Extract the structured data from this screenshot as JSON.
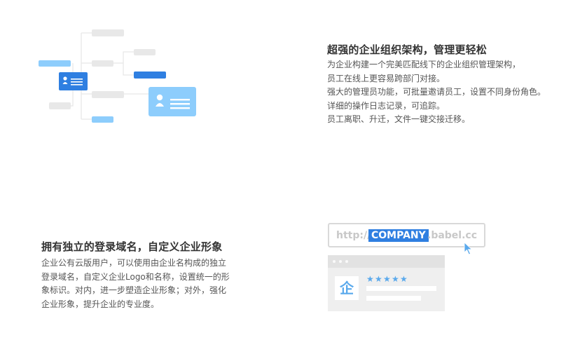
{
  "section_org": {
    "title": "超强的企业组织架构，管理更轻松",
    "lines": [
      "为企业构建一个完美匹配线下的企业组织管理架构，",
      "员工在线上更容易跨部门对接。",
      "强大的管理员功能，可批量邀请员工，设置不同身份角色。",
      "详细的操作日志记录，可追踪。",
      "员工离职、升迁，文件一键交接迁移。"
    ]
  },
  "section_domain": {
    "title": "拥有独立的登录域名，自定义企业形象",
    "lines": [
      "企业公有云版用户，可以使用由企业名构成的独立",
      "登录域名，自定义企业Logo和名称，设置统一的形",
      "象标识。对内，进一步塑造企业形象；对外，强化",
      "企业形象，提升企业的专业度。"
    ]
  },
  "url_demo": {
    "prefix": "http://",
    "company": "COMPANY",
    "suffix": ".babel.cc"
  },
  "logo_demo": {
    "glyph": "企",
    "stars": [
      "★",
      "★",
      "★",
      "★",
      "★"
    ]
  },
  "icons": {
    "org_chart": "org-chart-illustration",
    "cursor": "cursor-arrow-icon",
    "person": "person-card-icon"
  },
  "colors": {
    "accent": "#2f7fe1",
    "accent_light": "#8dcdfc",
    "placeholder": "#e8e8e8",
    "heading": "#333333",
    "body": "#555555"
  }
}
